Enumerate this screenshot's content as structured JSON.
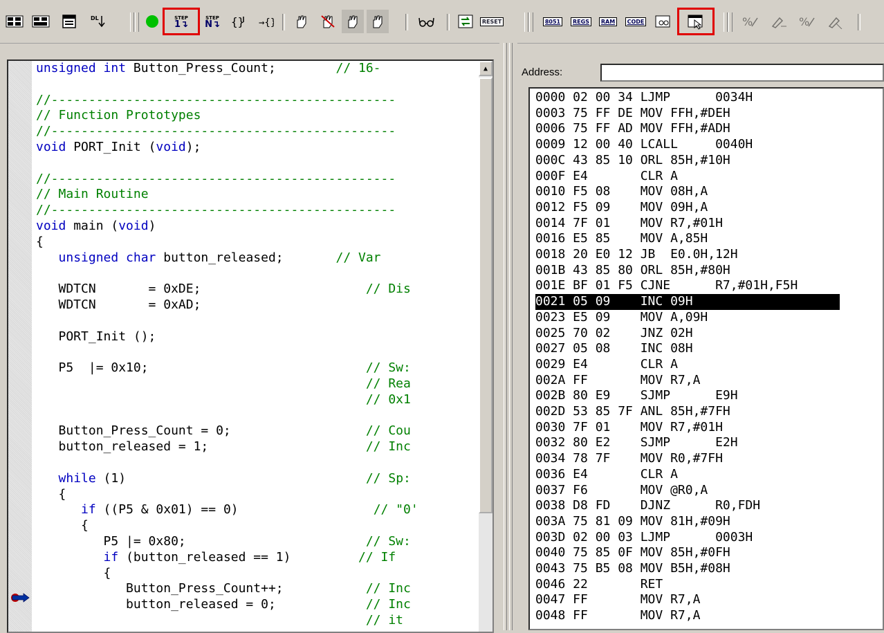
{
  "toolbar": {
    "left_buttons": [
      "reset-cpu-icon",
      "insert-remove-breakpoint-icon",
      "window-icon",
      "step-out-icon"
    ],
    "run_label": "run",
    "step_in_label": "STEP",
    "step_over_label": "STEP",
    "reset_label": "RESET",
    "right_buttons": [
      "8051",
      "REGS",
      "RAM",
      "CODE"
    ]
  },
  "editor": {
    "lines": [
      [
        {
          "t": "unsigned int ",
          "c": "kw"
        },
        {
          "t": "Button_Press_Count;        ",
          "c": ""
        },
        {
          "t": "// 16-",
          "c": "cm"
        }
      ],
      [
        {
          "t": "",
          "c": ""
        }
      ],
      [
        {
          "t": "//----------------------------------------------",
          "c": "cm"
        }
      ],
      [
        {
          "t": "// Function Prototypes",
          "c": "cm"
        }
      ],
      [
        {
          "t": "//----------------------------------------------",
          "c": "cm"
        }
      ],
      [
        {
          "t": "void",
          "c": "kw"
        },
        {
          "t": " PORT_Init (",
          "c": ""
        },
        {
          "t": "void",
          "c": "kw"
        },
        {
          "t": ");",
          "c": ""
        }
      ],
      [
        {
          "t": "",
          "c": ""
        }
      ],
      [
        {
          "t": "//----------------------------------------------",
          "c": "cm"
        }
      ],
      [
        {
          "t": "// Main Routine",
          "c": "cm"
        }
      ],
      [
        {
          "t": "//----------------------------------------------",
          "c": "cm"
        }
      ],
      [
        {
          "t": "void",
          "c": "kw"
        },
        {
          "t": " main (",
          "c": ""
        },
        {
          "t": "void",
          "c": "kw"
        },
        {
          "t": ")",
          "c": ""
        }
      ],
      [
        {
          "t": "{",
          "c": ""
        }
      ],
      [
        {
          "t": "   ",
          "c": ""
        },
        {
          "t": "unsigned char",
          "c": "kw"
        },
        {
          "t": " button_released;       ",
          "c": ""
        },
        {
          "t": "// Var",
          "c": "cm"
        }
      ],
      [
        {
          "t": "",
          "c": ""
        }
      ],
      [
        {
          "t": "   WDTCN       = 0xDE;                      ",
          "c": ""
        },
        {
          "t": "// Dis",
          "c": "cm"
        }
      ],
      [
        {
          "t": "   WDTCN       = 0xAD;",
          "c": ""
        }
      ],
      [
        {
          "t": "",
          "c": ""
        }
      ],
      [
        {
          "t": "   PORT_Init ();",
          "c": ""
        }
      ],
      [
        {
          "t": "",
          "c": ""
        }
      ],
      [
        {
          "t": "   P5  |= 0x10;                             ",
          "c": ""
        },
        {
          "t": "// Sw:",
          "c": "cm"
        }
      ],
      [
        {
          "t": "                                            ",
          "c": ""
        },
        {
          "t": "// Rea",
          "c": "cm"
        }
      ],
      [
        {
          "t": "                                            ",
          "c": ""
        },
        {
          "t": "// 0x1",
          "c": "cm"
        }
      ],
      [
        {
          "t": "",
          "c": ""
        }
      ],
      [
        {
          "t": "   Button_Press_Count = 0;                  ",
          "c": ""
        },
        {
          "t": "// Cou",
          "c": "cm"
        }
      ],
      [
        {
          "t": "   button_released = 1;                     ",
          "c": ""
        },
        {
          "t": "// Inc",
          "c": "cm"
        }
      ],
      [
        {
          "t": "",
          "c": ""
        }
      ],
      [
        {
          "t": "   ",
          "c": ""
        },
        {
          "t": "while",
          "c": "kw"
        },
        {
          "t": " (1)                                ",
          "c": ""
        },
        {
          "t": "// Sp:",
          "c": "cm"
        }
      ],
      [
        {
          "t": "   {",
          "c": ""
        }
      ],
      [
        {
          "t": "      ",
          "c": ""
        },
        {
          "t": "if",
          "c": "kw"
        },
        {
          "t": " ((P5 & 0x01) == 0)                  ",
          "c": ""
        },
        {
          "t": "// \"0'",
          "c": "cm"
        }
      ],
      [
        {
          "t": "      {",
          "c": ""
        }
      ],
      [
        {
          "t": "         P5 |= 0x80;                        ",
          "c": ""
        },
        {
          "t": "// Sw:",
          "c": "cm"
        }
      ],
      [
        {
          "t": "         ",
          "c": ""
        },
        {
          "t": "if",
          "c": "kw"
        },
        {
          "t": " (button_released == 1)         ",
          "c": ""
        },
        {
          "t": "// If",
          "c": "cm"
        }
      ],
      [
        {
          "t": "         {",
          "c": ""
        }
      ],
      [
        {
          "t": "            Button_Press_Count++;           ",
          "c": ""
        },
        {
          "t": "// Inc",
          "c": "cm"
        }
      ],
      [
        {
          "t": "            button_released = 0;            ",
          "c": ""
        },
        {
          "t": "// Inc",
          "c": "cm"
        }
      ],
      [
        {
          "t": "                                            ",
          "c": ""
        },
        {
          "t": "// it",
          "c": "cm"
        }
      ]
    ]
  },
  "disassembly": {
    "address_label": "Address:",
    "address_value": "",
    "selected_index": 12,
    "rows": [
      "0000 02 00 34 LJMP      0034H",
      "0003 75 FF DE MOV FFH,#DEH",
      "0006 75 FF AD MOV FFH,#ADH",
      "0009 12 00 40 LCALL     0040H",
      "000C 43 85 10 ORL 85H,#10H",
      "000F E4       CLR A",
      "0010 F5 08    MOV 08H,A",
      "0012 F5 09    MOV 09H,A",
      "0014 7F 01    MOV R7,#01H",
      "0016 E5 85    MOV A,85H",
      "0018 20 E0 12 JB  E0.0H,12H",
      "001B 43 85 80 ORL 85H,#80H",
      "0021 05 09    INC 09H",
      "0023 E5 09    MOV A,09H",
      "0025 70 02    JNZ 02H",
      "0027 05 08    INC 08H",
      "0029 E4       CLR A",
      "002A FF       MOV R7,A",
      "002B 80 E9    SJMP      E9H",
      "002D 53 85 7F ANL 85H,#7FH",
      "0030 7F 01    MOV R7,#01H",
      "0032 80 E2    SJMP      E2H",
      "0034 78 7F    MOV R0,#7FH",
      "0036 E4       CLR A",
      "0037 F6       MOV @R0,A",
      "0038 D8 FD    DJNZ      R0,FDH",
      "003A 75 81 09 MOV 81H,#09H",
      "003D 02 00 03 LJMP      0003H",
      "0040 75 85 0F MOV 85H,#0FH",
      "0043 75 B5 08 MOV B5H,#08H",
      "0046 22       RET",
      "0047 FF       MOV R7,A",
      "0048 FF       MOV R7,A"
    ],
    "cjne_row": "001E BF 01 F5 CJNE      R7,#01H,F5H"
  }
}
